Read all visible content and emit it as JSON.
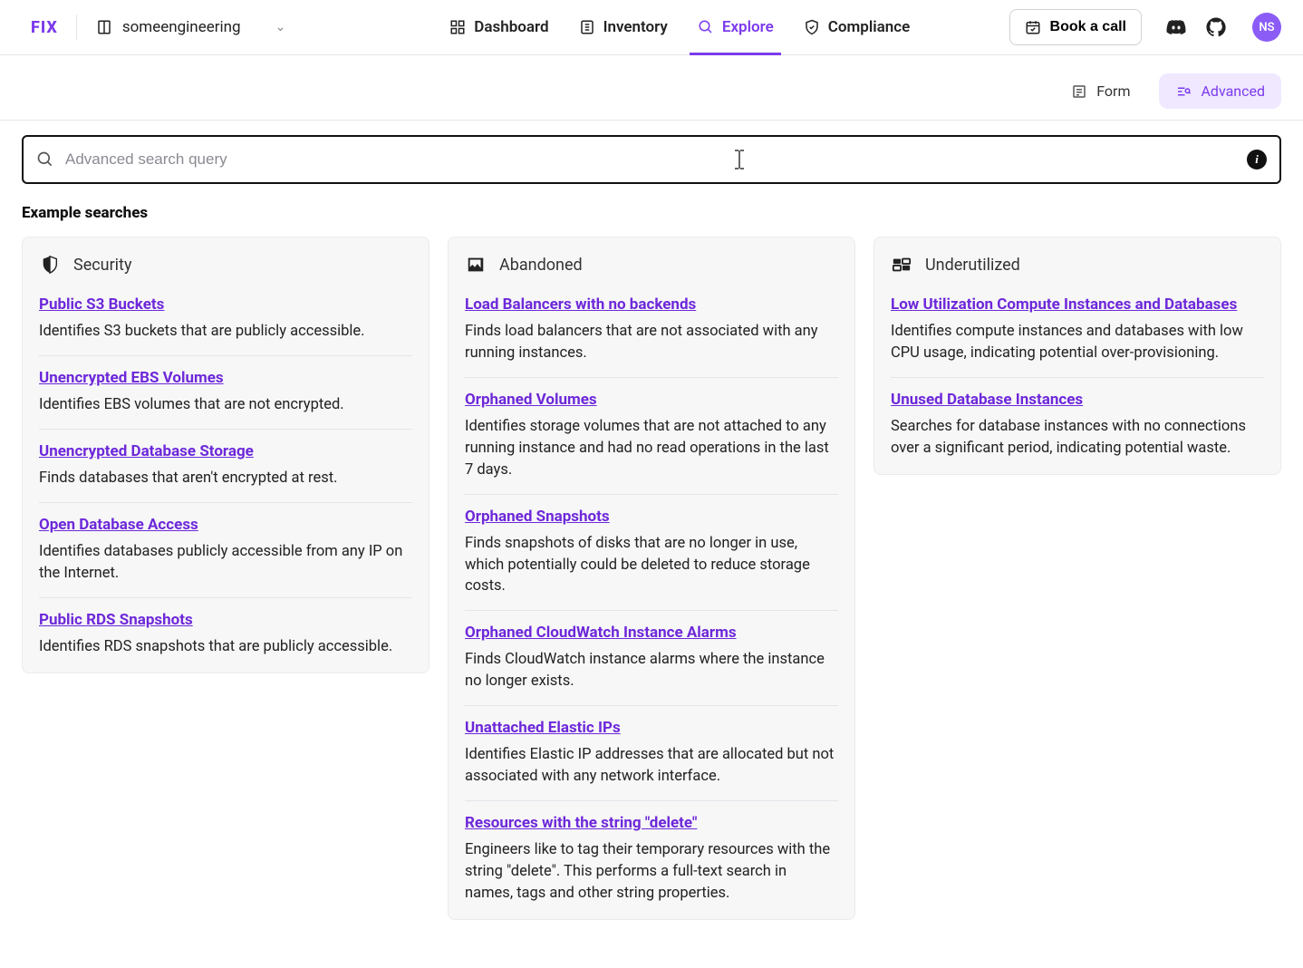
{
  "header": {
    "logo": "FIX",
    "workspace": "someengineering",
    "nav": {
      "dashboard": "Dashboard",
      "inventory": "Inventory",
      "explore": "Explore",
      "compliance": "Compliance"
    },
    "book_call": "Book a call",
    "avatar": "NS"
  },
  "subbar": {
    "form": "Form",
    "advanced": "Advanced"
  },
  "search": {
    "placeholder": "Advanced search query",
    "value": ""
  },
  "examples": {
    "title": "Example searches",
    "groups": [
      {
        "icon": "shield",
        "title": "Security",
        "items": [
          {
            "title": "Public S3 Buckets",
            "desc": "Identifies S3 buckets that are publicly accessible."
          },
          {
            "title": "Unencrypted EBS Volumes",
            "desc": "Identifies EBS volumes that are not encrypted."
          },
          {
            "title": "Unencrypted Database Storage",
            "desc": "Finds databases that aren't encrypted at rest."
          },
          {
            "title": "Open Database Access",
            "desc": "Identifies databases publicly accessible from any IP on the Internet."
          },
          {
            "title": "Public RDS Snapshots",
            "desc": "Identifies RDS snapshots that are publicly accessible."
          }
        ]
      },
      {
        "icon": "broken-image",
        "title": "Abandoned",
        "items": [
          {
            "title": "Load Balancers with no backends",
            "desc": "Finds load balancers that are not associated with any running instances."
          },
          {
            "title": "Orphaned Volumes",
            "desc": "Identifies storage volumes that are not attached to any running instance and had no read operations in the last 7 days."
          },
          {
            "title": "Orphaned Snapshots",
            "desc": "Finds snapshots of disks that are no longer in use, which potentially could be deleted to reduce storage costs."
          },
          {
            "title": "Orphaned CloudWatch Instance Alarms",
            "desc": "Finds CloudWatch instance alarms where the instance no longer exists."
          },
          {
            "title": "Unattached Elastic IPs",
            "desc": "Identifies Elastic IP addresses that are allocated but not associated with any network interface."
          },
          {
            "title": "Resources with the string \"delete\"",
            "desc": "Engineers like to tag their temporary resources with the string \"delete\". This performs a full-text search in names, tags and other string properties."
          }
        ]
      },
      {
        "icon": "gauge",
        "title": "Underutilized",
        "items": [
          {
            "title": "Low Utilization Compute Instances and Databases",
            "desc": "Identifies compute instances and databases with low CPU usage, indicating potential over-provisioning."
          },
          {
            "title": "Unused Database Instances",
            "desc": "Searches for database instances with no connections over a significant period, indicating potential waste."
          }
        ]
      }
    ]
  }
}
